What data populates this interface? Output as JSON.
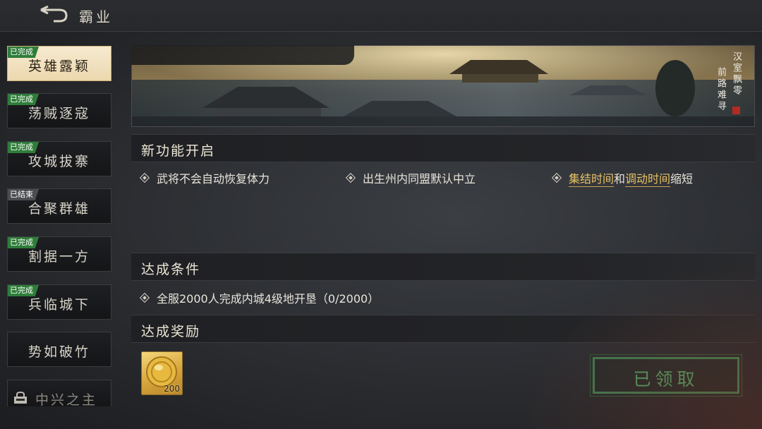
{
  "header": {
    "title": "霸业",
    "back_icon": "back-arrow-icon"
  },
  "sidebar": {
    "items": [
      {
        "label": "英雄露颖",
        "badge": "已完成",
        "active": true
      },
      {
        "label": "荡贼逐寇",
        "badge": "已完成"
      },
      {
        "label": "攻城拔寨",
        "badge": "已完成"
      },
      {
        "label": "合聚群雄",
        "badge": "已结束"
      },
      {
        "label": "割据一方",
        "badge": "已完成"
      },
      {
        "label": "兵临城下",
        "badge": "已完成"
      },
      {
        "label": "势如破竹",
        "badge": ""
      },
      {
        "label": "中兴之主",
        "badge": "",
        "locked": true
      }
    ]
  },
  "banner": {
    "caption_col1": "汉室飘零",
    "caption_col2": "前路难寻"
  },
  "features": {
    "title": "新功能开启",
    "items": [
      {
        "text": "武将不会自动恢复体力"
      },
      {
        "text": "出生州内同盟默认中立"
      },
      {
        "part1": "集结时间",
        "part2": "和",
        "part3": "调动时间",
        "part4": "缩短"
      }
    ]
  },
  "conditions": {
    "title": "达成条件",
    "items": [
      "全服2000人完成内城4级地开垦（0/2000）"
    ]
  },
  "rewards": {
    "title": "达成奖励",
    "items": [
      {
        "icon": "gold-coin-icon",
        "quantity": "200"
      }
    ],
    "claim_button": "已领取"
  },
  "colors": {
    "completed_badge": "#2f7d3a",
    "ended_badge": "#4b4d51",
    "highlight": "#e8c266",
    "claimed_green": "#4e9a62"
  }
}
